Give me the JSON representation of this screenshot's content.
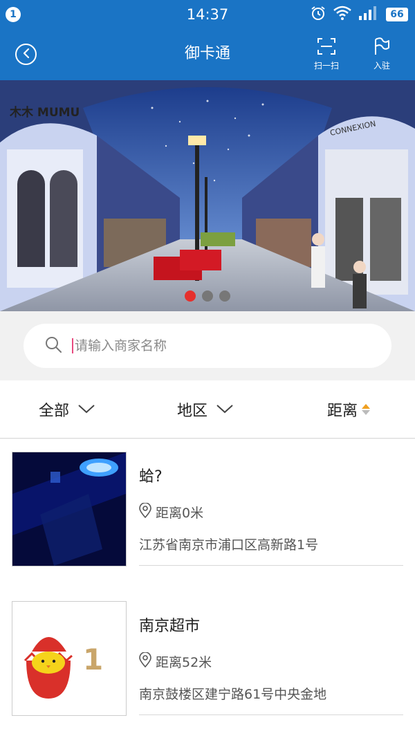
{
  "status_bar": {
    "notification_count": "1",
    "time": "14:37",
    "battery": "66",
    "icons": [
      "alarm-icon",
      "wifi-icon",
      "signal-icon",
      "battery-icon"
    ]
  },
  "header": {
    "title": "御卡通",
    "scan_label": "扫一扫",
    "enter_label": "入驻",
    "background_color": "#1a74c5"
  },
  "banner": {
    "slide_count": 3,
    "active_index": 0,
    "storefront_sign_left": "木木 MUMU",
    "storefront_sign_right": "CONNEXION"
  },
  "search": {
    "placeholder": "请输入商家名称",
    "value": ""
  },
  "filters": {
    "all_label": "全部",
    "area_label": "地区",
    "distance_label": "距离",
    "sort_up_color": "#f0a020"
  },
  "merchants": [
    {
      "name": "蛤?",
      "distance": "距离0米",
      "address": "江苏省南京市浦口区高新路1号",
      "thumbnail": "dark-blue-lit-room"
    },
    {
      "name": "南京超市",
      "distance": "距离52米",
      "address": "南京鼓楼区建宁路61号中央金地",
      "thumbnail_text": "1"
    }
  ],
  "colors": {
    "accent": "#1a74c5",
    "active_dot": "#e6302c"
  }
}
